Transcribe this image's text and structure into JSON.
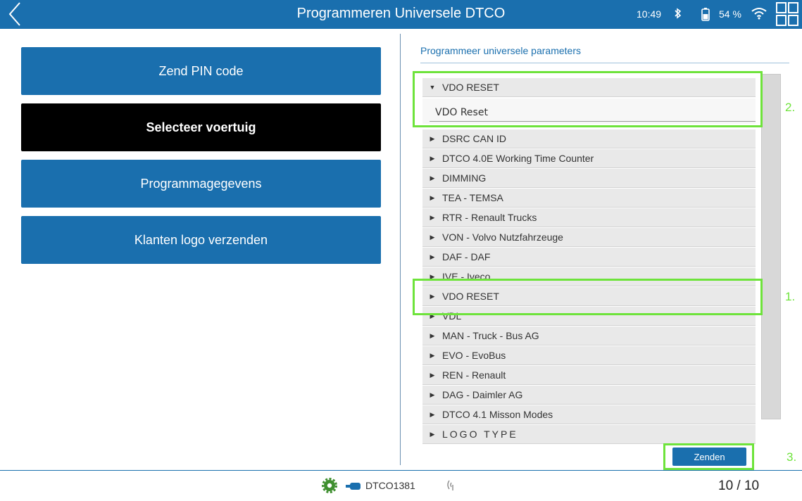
{
  "header": {
    "title": "Programmeren Universele DTCO",
    "time": "10:49",
    "battery": "54 %",
    "icons": [
      "back-chevron-icon",
      "bluetooth-icon",
      "battery-icon",
      "wifi-icon",
      "grid-menu-icon"
    ]
  },
  "left_menu": [
    {
      "label": "Zend PIN code",
      "active": false
    },
    {
      "label": "Selecteer voertuig",
      "active": true
    },
    {
      "label": "Programmagegevens",
      "active": false
    },
    {
      "label": "Klanten logo verzenden",
      "active": false
    }
  ],
  "panel": {
    "title": "Programmeer universele parameters",
    "expanded_item": "VDO RESET",
    "expanded_value": "VDO Reset",
    "items": [
      "DSRC CAN ID",
      "DTCO 4.0E Working Time Counter",
      "DIMMING",
      "TEA - TEMSA",
      "RTR - Renault Trucks",
      "VON - Volvo Nutzfahrzeuge",
      "DAF - DAF",
      "IVE - Iveco",
      "VDO RESET",
      "VDL",
      "MAN - Truck - Bus AG",
      "EVO - EvoBus",
      "REN - Renault",
      "DAG - Daimler AG",
      "DTCO 4.1 Misson Modes",
      "LOGO TYPE"
    ],
    "send_label": "Zenden"
  },
  "annotations": [
    "2.",
    "1.",
    "3."
  ],
  "colors": {
    "accent": "#1a6fae",
    "highlight": "#6ee33b",
    "active_button": "#000000"
  },
  "footer": {
    "device": "DTCO1381",
    "page": "10 / 10",
    "icons": [
      "gear-icon",
      "connector-icon",
      "signal-icon"
    ]
  }
}
